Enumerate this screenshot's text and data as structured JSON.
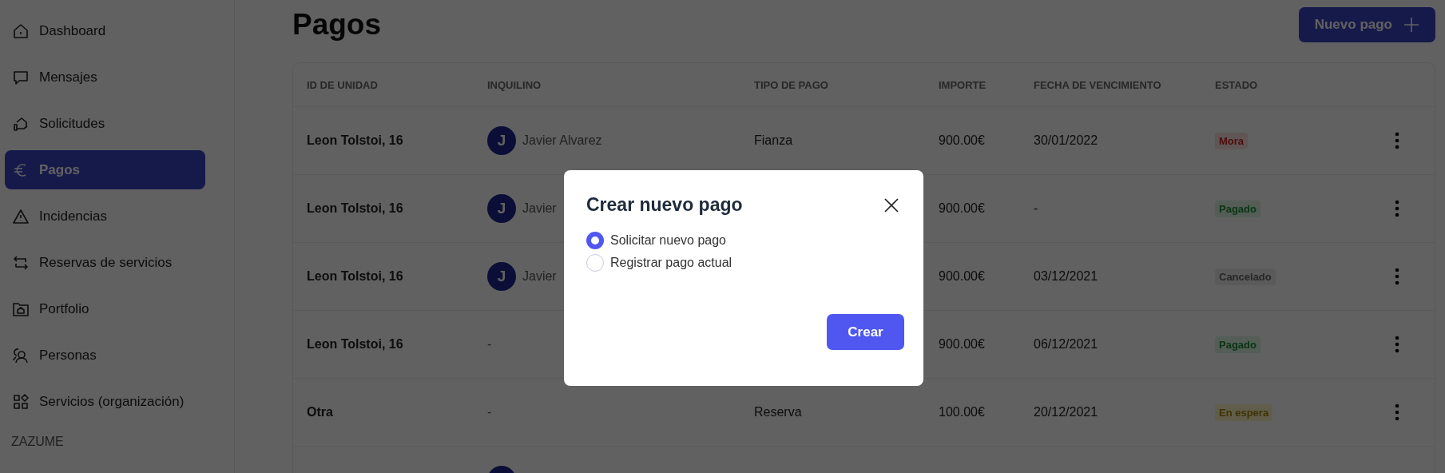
{
  "sidebar": {
    "items": [
      {
        "label": "Dashboard",
        "selected": false
      },
      {
        "label": "Mensajes",
        "selected": false
      },
      {
        "label": "Solicitudes",
        "selected": false
      },
      {
        "label": "Pagos",
        "selected": true
      },
      {
        "label": "Incidencias",
        "selected": false
      },
      {
        "label": "Reservas de servicios",
        "selected": false
      },
      {
        "label": "Portfolio",
        "selected": false
      },
      {
        "label": "Personas",
        "selected": false
      },
      {
        "label": "Servicios (organización)",
        "selected": false
      }
    ],
    "section": "ZAZUME"
  },
  "header": {
    "title": "Pagos",
    "button": "Nuevo pago"
  },
  "table": {
    "columns": [
      "ID DE UNIDAD",
      "INQUILINO",
      "TIPO DE PAGO",
      "IMPORTE",
      "FECHA DE VENCIMIENTO",
      "ESTADO"
    ],
    "rows": [
      {
        "unit": "Leon Tolstoi, 16",
        "tenant": {
          "initial": "J",
          "name": "Javier Alvarez"
        },
        "type": "Fianza",
        "amount": "900.00€",
        "due": "30/01/2022",
        "status": {
          "label": "Mora",
          "kind": "late"
        }
      },
      {
        "unit": "Leon Tolstoi, 16",
        "tenant": {
          "initial": "J",
          "name": "Javier"
        },
        "amount": "900.00€",
        "due": "-",
        "status": {
          "label": "Pagado",
          "kind": "paid"
        }
      },
      {
        "unit": "Leon Tolstoi, 16",
        "tenant": {
          "initial": "J",
          "name": "Javier"
        },
        "amount": "900.00€",
        "due": "03/12/2021",
        "status": {
          "label": "Cancelado",
          "kind": "cancelled"
        }
      },
      {
        "unit": "Leon Tolstoi, 16",
        "tenant_text": "-",
        "amount": "900.00€",
        "due": "06/12/2021",
        "status": {
          "label": "Pagado",
          "kind": "paid"
        }
      },
      {
        "unit": "Otra",
        "tenant_text": "-",
        "type": "Reserva",
        "amount": "100.00€",
        "due": "20/12/2021",
        "status": {
          "label": "En espera",
          "kind": "pending"
        }
      },
      {
        "tenant": {}
      }
    ]
  },
  "modal": {
    "title": "Crear nuevo pago",
    "options": [
      {
        "label": "Solicitar nuevo pago",
        "selected": true
      },
      {
        "label": "Registrar pago actual",
        "selected": false
      }
    ],
    "button": "Crear"
  }
}
